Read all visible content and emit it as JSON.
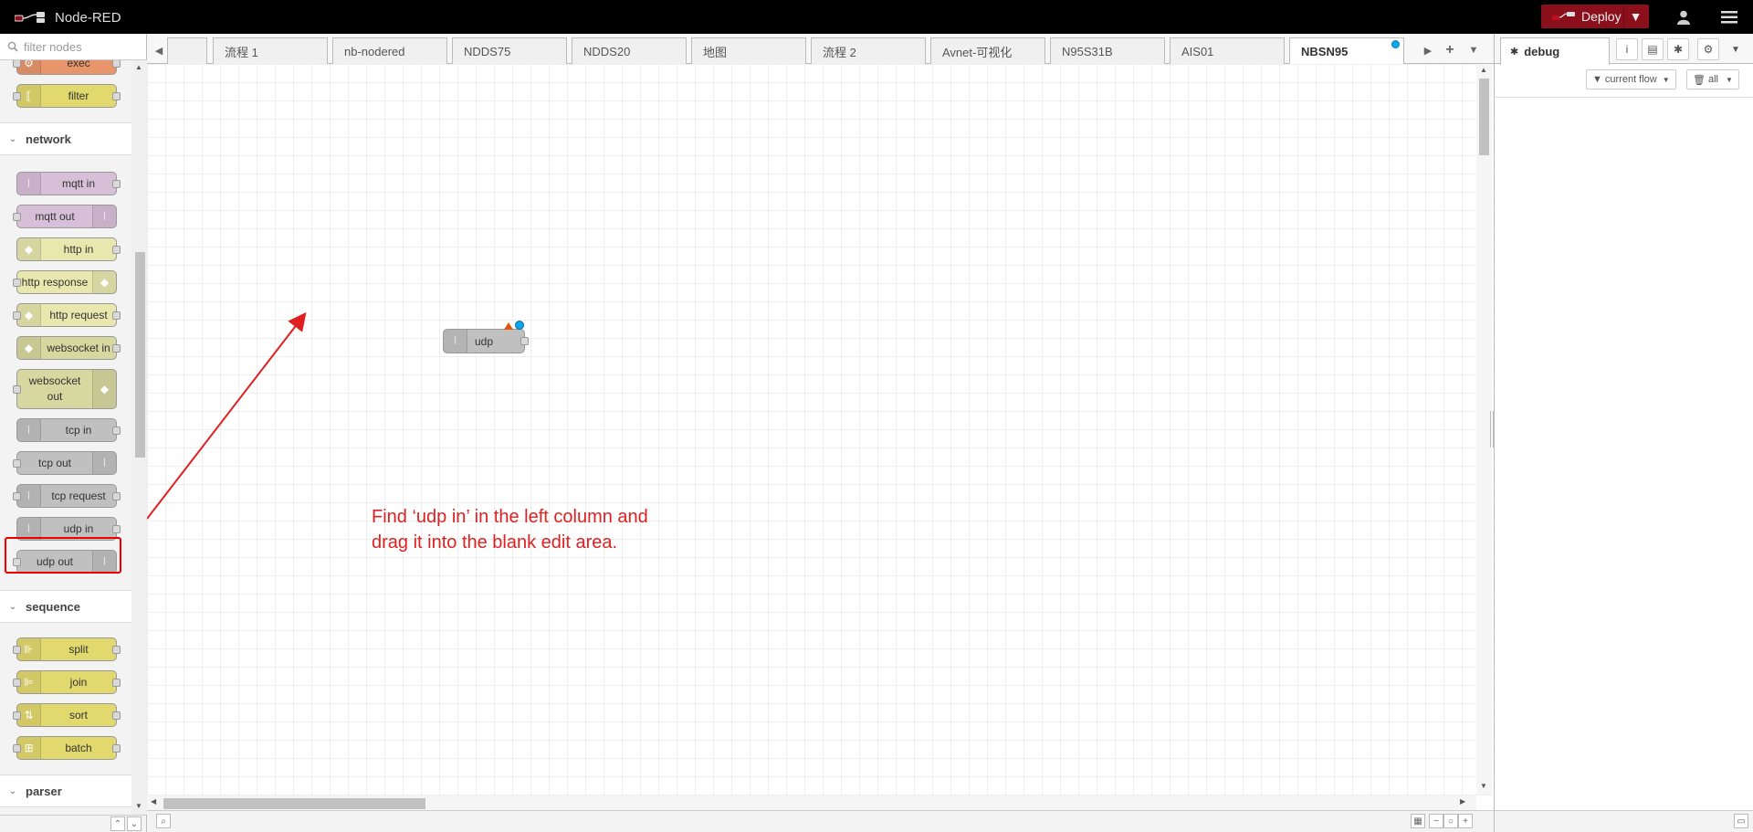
{
  "header": {
    "app_title": "Node-RED",
    "deploy_label": "Deploy",
    "user_icon": "user-icon",
    "menu_icon": "hamburger-menu-icon",
    "bg_color": "#000000",
    "deploy_color": "#8c101c"
  },
  "palette": {
    "search_placeholder": "filter nodes",
    "top_nodes": [
      {
        "label": "exec",
        "color": "#e9956c"
      },
      {
        "label": "filter",
        "color": "#e2d96e"
      }
    ],
    "categories": {
      "network": "network",
      "sequence": "sequence",
      "parser": "parser"
    },
    "network_nodes": [
      {
        "label": "mqtt in",
        "color": "#d8bfd8",
        "icon": "wifi-icon"
      },
      {
        "label": "mqtt out",
        "color": "#d8bfd8",
        "icon": "wifi-icon"
      },
      {
        "label": "http in",
        "color": "#e7e7ae",
        "icon": "globe-icon"
      },
      {
        "label": "http response",
        "color": "#e7e7ae",
        "icon": "globe-icon"
      },
      {
        "label": "http request",
        "color": "#e7e7ae",
        "icon": "globe-icon"
      },
      {
        "label": "websocket in",
        "color": "#d7d7a0",
        "icon": "globe-icon"
      },
      {
        "label": "websocket out",
        "color": "#d7d7a0",
        "icon": "globe-icon"
      },
      {
        "label": "tcp in",
        "color": "#c0c0c0",
        "icon": "wifi-icon"
      },
      {
        "label": "tcp out",
        "color": "#c0c0c0",
        "icon": "wifi-icon"
      },
      {
        "label": "tcp request",
        "color": "#c0c0c0",
        "icon": "wifi-icon"
      },
      {
        "label": "udp in",
        "color": "#c0c0c0",
        "icon": "wifi-icon"
      },
      {
        "label": "udp out",
        "color": "#c0c0c0",
        "icon": "wifi-icon"
      }
    ],
    "sequence_nodes": [
      {
        "label": "split",
        "color": "#e2d96e",
        "icon": "split-icon"
      },
      {
        "label": "join",
        "color": "#e2d96e",
        "icon": "join-icon"
      },
      {
        "label": "sort",
        "color": "#e2d96e",
        "icon": "sort-icon"
      },
      {
        "label": "batch",
        "color": "#e2d96e",
        "icon": "batch-icon"
      }
    ]
  },
  "tabs": [
    {
      "label": ""
    },
    {
      "label": "流程 1"
    },
    {
      "label": "nb-nodered"
    },
    {
      "label": "NDDS75"
    },
    {
      "label": "NDDS20"
    },
    {
      "label": "地图"
    },
    {
      "label": "流程 2"
    },
    {
      "label": "Avnet-可视化"
    },
    {
      "label": "N95S31B"
    },
    {
      "label": "AIS01"
    },
    {
      "label": "NBSN95"
    }
  ],
  "workspace": {
    "node_label": "udp",
    "annotation_line1": "Find  ‘udp in’  in the left column and",
    "annotation_line2": "drag it into the blank edit area."
  },
  "sidebar": {
    "active_tab": "debug",
    "filter_label": "current flow",
    "clear_label": "all",
    "icons": [
      "info-icon",
      "book-icon",
      "bug-icon",
      "gear-icon"
    ]
  }
}
